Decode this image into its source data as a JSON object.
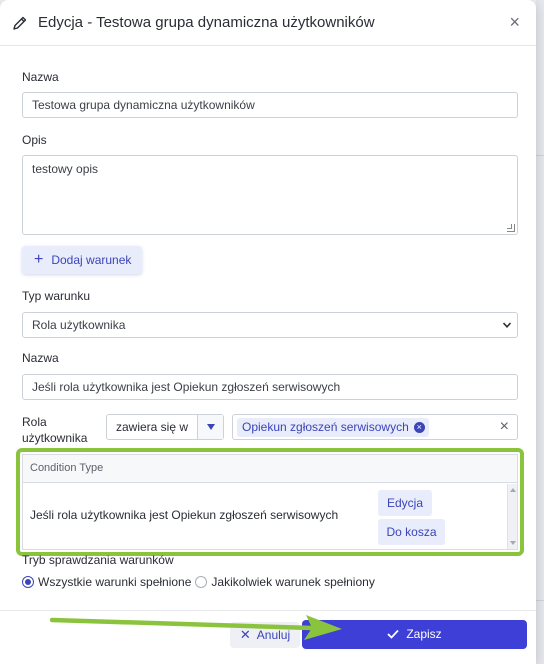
{
  "dialog": {
    "title": "Edycja - Testowa grupa dynamiczna użytkowników",
    "close_label": "×"
  },
  "form": {
    "name_label": "Nazwa",
    "name_value": "Testowa grupa dynamiczna użytkowników",
    "description_label": "Opis",
    "description_value": "testowy opis",
    "add_condition_label": "Dodaj warunek",
    "condition_type_label": "Typ warunku",
    "condition_type_value": "Rola użytkownika",
    "condition_name_label": "Nazwa",
    "condition_name_value": "Jeśli rola użytkownika jest Opiekun zgłoszeń serwisowych",
    "role_label": "Rola użytkownika",
    "operator_value": "zawiera się w",
    "role_chip": "Opiekun zgłoszeń serwisowych",
    "clear_label": "×"
  },
  "grid": {
    "header": "Condition Type",
    "rows": [
      {
        "text": "Jeśli rola użytkownika jest Opiekun zgłoszeń serwisowych",
        "edit_label": "Edycja",
        "delete_label": "Do kosza"
      }
    ]
  },
  "mode": {
    "label": "Tryb sprawdzania warunków",
    "option_all": "Wszystkie warunki spełnione",
    "option_any": "Jakikolwiek warunek spełniony",
    "selected": "option_all"
  },
  "footer": {
    "cancel_label": "Anuluj",
    "save_label": "Zapisz"
  },
  "colors": {
    "accent": "#3d3fd6",
    "accent_soft": "#e9ecfb",
    "highlight": "#8ac43d"
  }
}
